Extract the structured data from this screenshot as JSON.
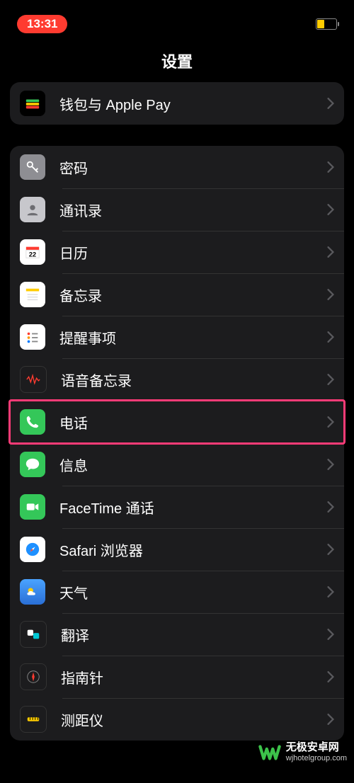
{
  "status": {
    "time": "13:31"
  },
  "title": "设置",
  "group1": {
    "items": [
      {
        "label": "钱包与 Apple Pay"
      }
    ]
  },
  "group2": {
    "items": [
      {
        "label": "密码"
      },
      {
        "label": "通讯录"
      },
      {
        "label": "日历"
      },
      {
        "label": "备忘录"
      },
      {
        "label": "提醒事项"
      },
      {
        "label": "语音备忘录"
      },
      {
        "label": "电话"
      },
      {
        "label": "信息"
      },
      {
        "label": "FaceTime 通话"
      },
      {
        "label": "Safari 浏览器"
      },
      {
        "label": "天气"
      },
      {
        "label": "翻译"
      },
      {
        "label": "指南针"
      },
      {
        "label": "测距仪"
      }
    ]
  },
  "watermark": {
    "cn": "无极安卓网",
    "url": "wjhotelgroup.com"
  }
}
